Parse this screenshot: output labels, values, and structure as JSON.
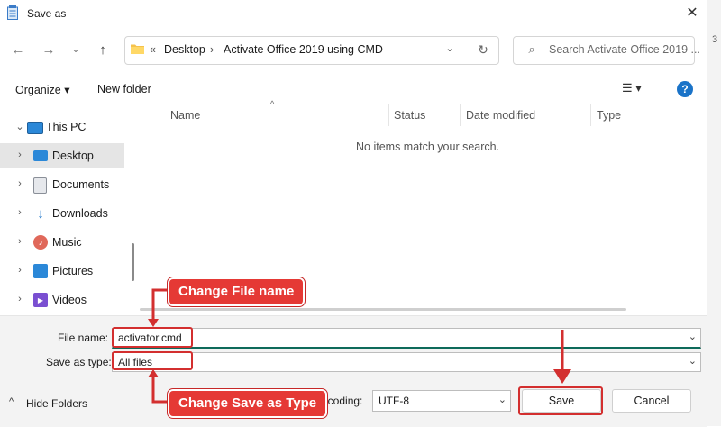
{
  "window": {
    "title": "Save as",
    "close_glyph": "✕",
    "edge_text": "3"
  },
  "nav": {
    "back_glyph": "←",
    "forward_glyph": "→",
    "recent_glyph": "⌄",
    "up_glyph": "↑",
    "address": {
      "overflow": "«",
      "crumbs": [
        "Desktop",
        "Activate Office 2019 using CMD"
      ],
      "sep": "›",
      "dropdown_glyph": "⌄",
      "refresh_glyph": "↻"
    },
    "search": {
      "placeholder": "Search Activate Office 2019 ...",
      "icon_glyph": "⌕"
    }
  },
  "toolbar": {
    "organize": "Organize ▾",
    "new_folder": "New folder",
    "view_glyph": "☰ ▾",
    "help_glyph": "?"
  },
  "sidebar": {
    "items": [
      {
        "label": "This PC",
        "icon": "computer-icon",
        "chev": "⌄",
        "color": "#2b88d8"
      },
      {
        "label": "Desktop",
        "icon": "desktop-icon",
        "chev": "›",
        "color": "#2b88d8"
      },
      {
        "label": "Documents",
        "icon": "documents-icon",
        "chev": "›",
        "color": "#8a8f98"
      },
      {
        "label": "Downloads",
        "icon": "downloads-icon",
        "chev": "›",
        "color": "#1a73c8"
      },
      {
        "label": "Music",
        "icon": "music-icon",
        "chev": "›",
        "color": "#e0685a"
      },
      {
        "label": "Pictures",
        "icon": "pictures-icon",
        "chev": "›",
        "color": "#2b88d8"
      },
      {
        "label": "Videos",
        "icon": "videos-icon",
        "chev": "›",
        "color": "#7a4fd1"
      }
    ]
  },
  "filelist": {
    "columns": [
      "Name",
      "Status",
      "Date modified",
      "Type"
    ],
    "sort_glyph": "^",
    "empty_message": "No items match your search."
  },
  "form": {
    "file_name_label": "File name:",
    "file_name_value": "activator.cmd",
    "save_type_label": "Save as type:",
    "save_type_value": "All files",
    "encoding_label": "Encoding:",
    "encoding_value": "UTF-8",
    "chev_glyph": "⌄"
  },
  "footer": {
    "hide_folders": "Hide Folders",
    "hide_glyph": "^",
    "save": "Save",
    "cancel": "Cancel"
  },
  "annotations": {
    "change_file_name": "Change File name",
    "change_save_type": "Change Save as Type",
    "accent": "#e53935"
  }
}
